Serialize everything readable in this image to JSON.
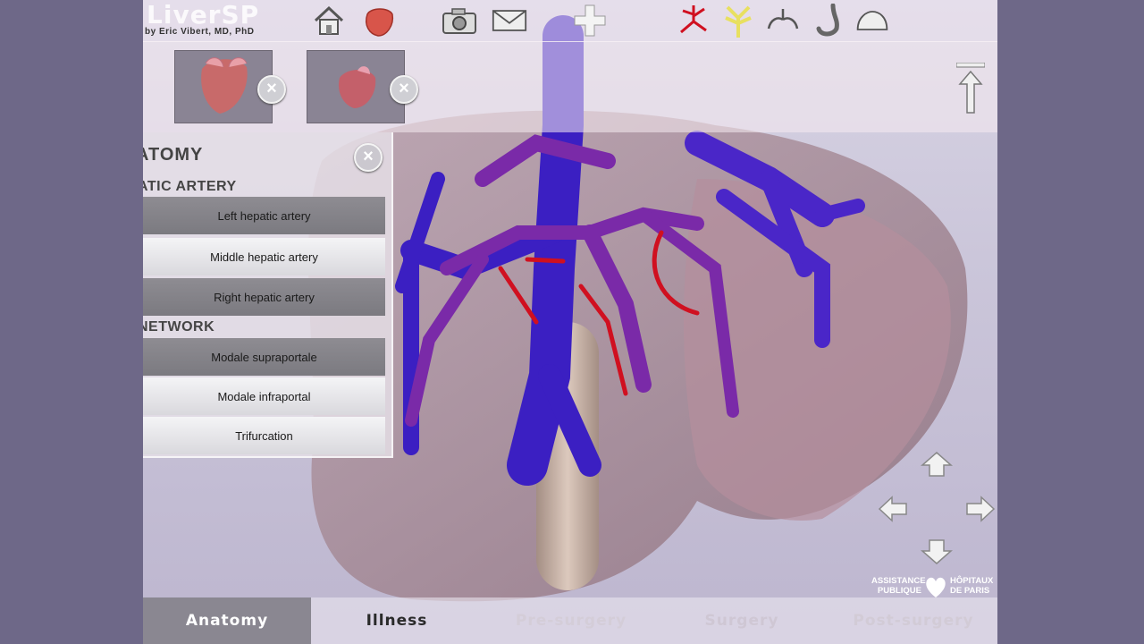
{
  "app": {
    "brand": "LiverSP",
    "byline": "by Eric Vibert, MD, PhD"
  },
  "toolbar": {
    "icons": [
      "home-icon",
      "liver-icon",
      "camera-icon",
      "mail-icon",
      "plus-icon",
      "artery-icon",
      "biliary-icon",
      "lungs-icon",
      "stomach-icon",
      "pancreas-icon"
    ]
  },
  "panel": {
    "title": "ATOMY",
    "sections": [
      {
        "label": "ATIC ARTERY",
        "items": [
          "Left hepatic artery",
          "Middle hepatic artery",
          "Right hepatic artery"
        ]
      },
      {
        "label": "NETWORK",
        "items": [
          "Modale supraportale",
          "Modale infraportal",
          "Trifurcation"
        ]
      }
    ]
  },
  "logo": {
    "line1_left": "ASSISTANCE",
    "line2_left": "PUBLIQUE",
    "line1_right": "HÔPITAUX",
    "line2_right": "DE PARIS"
  },
  "tabs": [
    "Anatomy",
    "Illness",
    "Pre-surgery",
    "Surgery",
    "Post-surgery"
  ],
  "colors": {
    "portal_vein": "#3b1fc2",
    "hepatic_artery": "#d01020",
    "purple_vessel": "#7a2aa8",
    "active_tab": "#8a8791",
    "bg_side": "#6e6888"
  }
}
